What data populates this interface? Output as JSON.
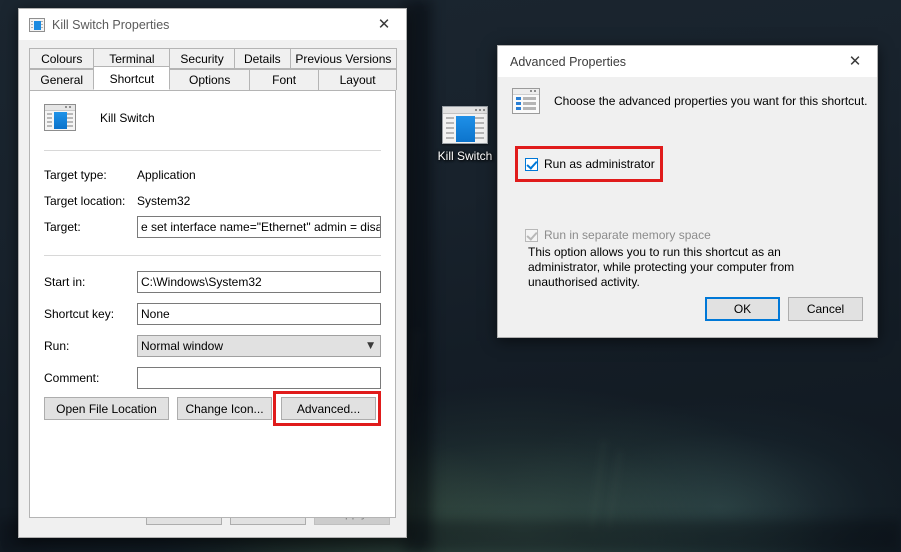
{
  "desktop": {
    "icon": {
      "label": "Kill Switch",
      "icon_name": "batch-script-icon"
    },
    "wallpaper_colors": {
      "base": "#18222c",
      "foliage": "#4d7a66"
    }
  },
  "properties_window": {
    "title": "Kill Switch Properties",
    "title_icon": "batch-script-icon",
    "close_label": "✕",
    "tabs_row1": [
      {
        "label": "Colours",
        "selected": false
      },
      {
        "label": "Terminal",
        "selected": false
      },
      {
        "label": "Security",
        "selected": false
      },
      {
        "label": "Details",
        "selected": false
      },
      {
        "label": "Previous Versions",
        "selected": false
      }
    ],
    "tabs_row2": [
      {
        "label": "General",
        "selected": false
      },
      {
        "label": "Shortcut",
        "selected": true
      },
      {
        "label": "Options",
        "selected": false
      },
      {
        "label": "Font",
        "selected": false
      },
      {
        "label": "Layout",
        "selected": false
      }
    ],
    "shortcut_header": {
      "name": "Kill Switch",
      "icon_name": "batch-script-icon"
    },
    "fields": {
      "target_type_label": "Target type:",
      "target_type_value": "Application",
      "target_location_label": "Target location:",
      "target_location_value": "System32",
      "target_label": "Target:",
      "target_value": "e set interface name=\"Ethernet\" admin = disabled",
      "start_in_label": "Start in:",
      "start_in_value": "C:\\Windows\\System32",
      "shortcut_key_label": "Shortcut key:",
      "shortcut_key_value": "None",
      "run_label": "Run:",
      "run_value": "Normal window",
      "comment_label": "Comment:",
      "comment_value": ""
    },
    "action_buttons": {
      "open_file_location": "Open File Location",
      "change_icon": "Change Icon...",
      "advanced": "Advanced..."
    },
    "dialog_buttons": {
      "ok": "OK",
      "cancel": "Cancel",
      "apply": "Apply",
      "apply_disabled": true
    }
  },
  "advanced_dialog": {
    "title": "Advanced Properties",
    "close_label": "✕",
    "icon_name": "advanced-properties-icon",
    "intro_text": "Choose the advanced properties you want for this shortcut.",
    "run_as_admin": {
      "label": "Run as administrator",
      "checked": true
    },
    "description": "This option allows you to run this shortcut as an administrator, while protecting your computer from unauthorised activity.",
    "run_separate_memory": {
      "label": "Run in separate memory space",
      "checked": true,
      "disabled": true
    },
    "buttons": {
      "ok": "OK",
      "cancel": "Cancel"
    }
  },
  "annotations": {
    "highlight_color": "#e01b1b",
    "boxes": [
      "advanced-button-highlight",
      "run-as-administrator-highlight"
    ]
  }
}
